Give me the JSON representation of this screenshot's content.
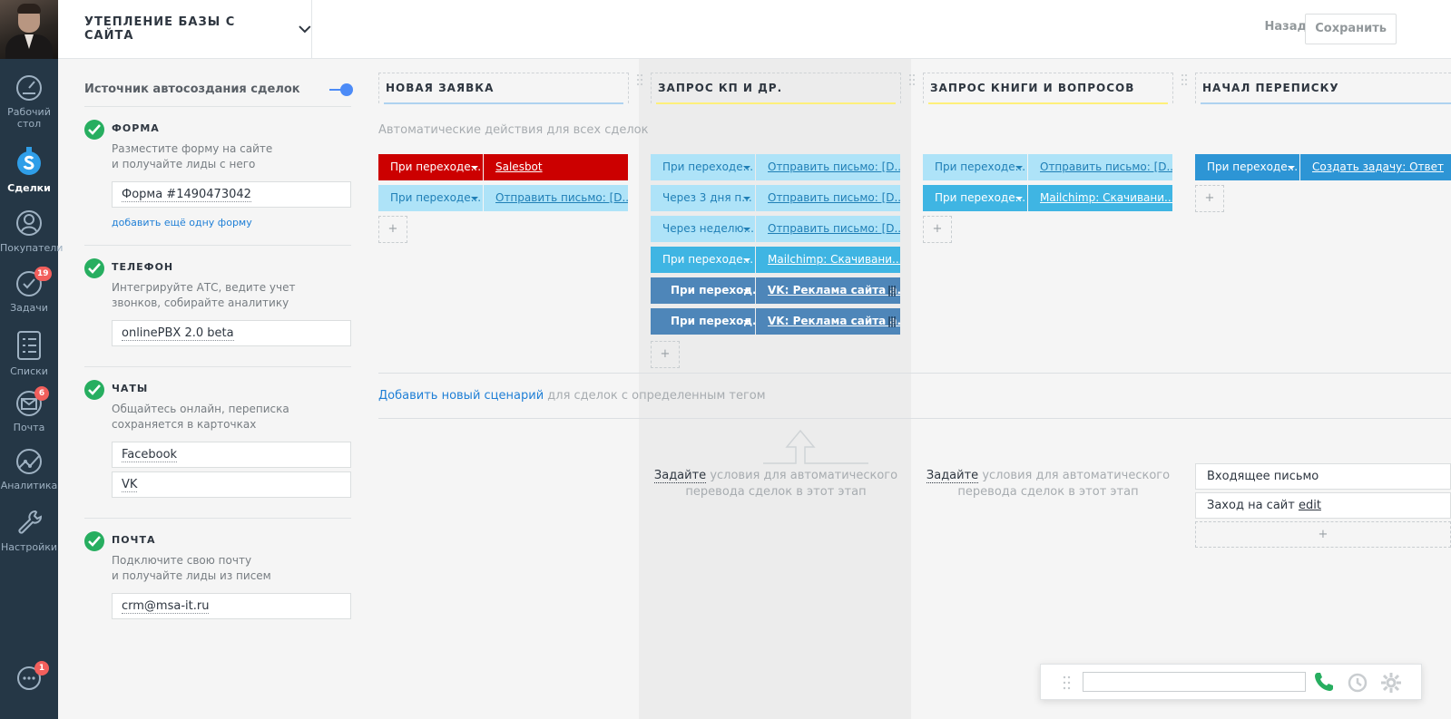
{
  "nav": {
    "items": [
      {
        "label_1": "Рабочий",
        "label_2": "стол",
        "icon": "dashboard-icon"
      },
      {
        "label_1": "Сделки",
        "icon": "deals-icon"
      },
      {
        "label_1": "Покупатели",
        "icon": "customers-icon"
      },
      {
        "label_1": "Задачи",
        "icon": "tasks-icon",
        "badge": "19"
      },
      {
        "label_1": "Списки",
        "icon": "lists-icon"
      },
      {
        "label_1": "Почта",
        "icon": "mail-icon",
        "badge": "6"
      },
      {
        "label_1": "Аналитика",
        "icon": "analytics-icon"
      },
      {
        "label_1": "Настройки",
        "icon": "settings-icon"
      }
    ],
    "chat_badge": "1"
  },
  "header": {
    "title": "УТЕПЛЕНИЕ БАЗЫ С САЙТА",
    "back_label": "Назад",
    "save_label": "Сохранить"
  },
  "settings": {
    "title": "Источник автосоздания сделок",
    "sources": [
      {
        "name": "ФОРМА",
        "desc_1": "Разместите форму на сайте",
        "desc_2": "и получайте лиды с него",
        "values": [
          "Форма #1490473042"
        ],
        "add_link": "добавить ещё одну форму"
      },
      {
        "name": "ТЕЛЕФОН",
        "desc_1": "Интегрируйте АТС, ведите учет",
        "desc_2": "звонков, собирайте аналитику",
        "values": [
          "onlinePBX 2.0 beta"
        ]
      },
      {
        "name": "ЧАТЫ",
        "desc_1": "Общайтесь онлайн, переписка",
        "desc_2": "сохраняется в карточках",
        "values": [
          "Facebook",
          "VK"
        ]
      },
      {
        "name": "ПОЧТА",
        "desc_1": "Подключите свою почту",
        "desc_2": "и получайте лиды из писем",
        "values": [
          "crm@msa-it.ru"
        ]
      }
    ]
  },
  "pipeline": {
    "auto_label": "Автоматические действия для всех сделок",
    "columns": [
      {
        "name": "НОВАЯ ЗАЯВКА",
        "underline": "#aed2f0",
        "triggers": [
          {
            "cond": "При переходе...",
            "action": "Salesbot",
            "style": "red"
          },
          {
            "cond": "При переходе...",
            "action": "Отправить письмо: [D...",
            "style": "light"
          }
        ]
      },
      {
        "name": "ЗАПРОС КП И ДР.",
        "underline": "#fff07a",
        "triggers": [
          {
            "cond": "При переходе...",
            "action": "Отправить письмо: [D...",
            "style": "light"
          },
          {
            "cond": "Через 3 дня п...",
            "action": "Отправить письмо: [D...",
            "style": "light"
          },
          {
            "cond": "Через неделю...",
            "action": "Отправить письмо: [D...",
            "style": "light"
          },
          {
            "cond": "При переходе...",
            "action": "Mailchimp: Скачивани...",
            "style": "mid"
          },
          {
            "cond": "При переход...",
            "action": "VK: Реклама сайта а...",
            "style": "drag"
          },
          {
            "cond": "При переход...",
            "action": "VK: Реклама сайта а...",
            "style": "drag"
          }
        ],
        "hint_link": "Задайте",
        "hint_1": "условия для автоматического",
        "hint_2": "перевода сделок в этот этап"
      },
      {
        "name": "ЗАПРОС КНИГИ И ВОПРОСОВ",
        "underline": "#fff07a",
        "triggers": [
          {
            "cond": "При переходе...",
            "action": "Отправить письмо: [D...",
            "style": "light"
          },
          {
            "cond": "При переходе...",
            "action": "Mailchimp: Скачивани...",
            "style": "mid"
          }
        ],
        "hint_link": "Задайте",
        "hint_1": "условия для автоматического",
        "hint_2": "перевода сделок в этот этап"
      },
      {
        "name": "НАЧАЛ ПЕРЕПИСКУ",
        "underline": "#aed2f0",
        "triggers": [
          {
            "cond": "При переходе...",
            "action": "Создать задачу: Ответ",
            "style": "dark"
          }
        ],
        "events": [
          "Входящее письмо",
          "Заход на сайт"
        ],
        "event_edit": "edit"
      }
    ],
    "scenario_link": "Добавить новый сценарий",
    "scenario_text": " для сделок с определенным тегом"
  },
  "colors": {
    "nav_bg": "#253746",
    "accent": "#1f7fd6",
    "check": "#27ae60",
    "badge": "#f25f5c",
    "call": "#27ae60"
  }
}
